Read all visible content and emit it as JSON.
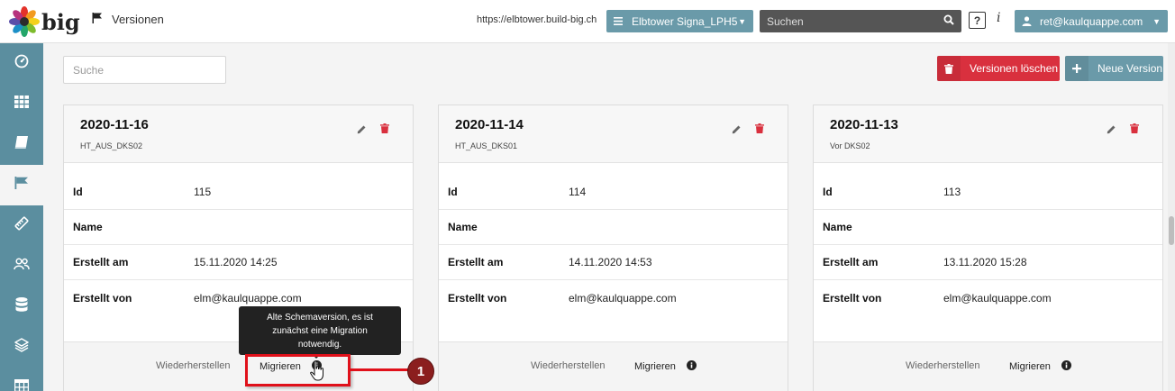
{
  "header": {
    "logo_text": "big",
    "page_title": "Versionen",
    "url": "https://elbtower.build-big.ch",
    "project": "Elbtower Signa_LPH5",
    "search_placeholder": "Suchen",
    "help_label": "?",
    "info_label": "i",
    "user": "ret@kaulquappe.com"
  },
  "toolbar": {
    "search_placeholder": "Suche",
    "delete_label": "Versionen löschen",
    "new_label": "Neue Version"
  },
  "labels": {
    "id": "Id",
    "name": "Name",
    "created_at": "Erstellt am",
    "created_by": "Erstellt von",
    "restore": "Wiederherstellen",
    "migrate": "Migrieren"
  },
  "cards": [
    {
      "date": "2020-11-16",
      "sub": "HT_AUS_DKS02",
      "id": "115",
      "name": "",
      "created_at": "15.11.2020 14:25",
      "created_by": "elm@kaulquappe.com"
    },
    {
      "date": "2020-11-14",
      "sub": "HT_AUS_DKS01",
      "id": "114",
      "name": "",
      "created_at": "14.11.2020 14:53",
      "created_by": "elm@kaulquappe.com"
    },
    {
      "date": "2020-11-13",
      "sub": "Vor DKS02",
      "id": "113",
      "name": "",
      "created_at": "13.11.2020 15:28",
      "created_by": "elm@kaulquappe.com"
    }
  ],
  "tooltip": {
    "line1": "Alte Schemaversion, es ist",
    "line2": "zunächst eine Migration",
    "line3": "notwendig."
  },
  "annotation": {
    "marker": "1"
  },
  "sidebar": {
    "items": [
      {
        "icon": "dashboard-icon"
      },
      {
        "icon": "grid-icon"
      },
      {
        "icon": "book-icon"
      },
      {
        "icon": "flag-icon",
        "active": true
      },
      {
        "icon": "ruler-icon"
      },
      {
        "icon": "users-icon"
      },
      {
        "icon": "database-icon"
      },
      {
        "icon": "layers-icon"
      },
      {
        "icon": "table-icon"
      }
    ]
  },
  "colors": {
    "accent": "#6a9aa9",
    "sidebar": "#5b8e9f",
    "danger": "#d9303e",
    "annotation": "#e0101a"
  }
}
